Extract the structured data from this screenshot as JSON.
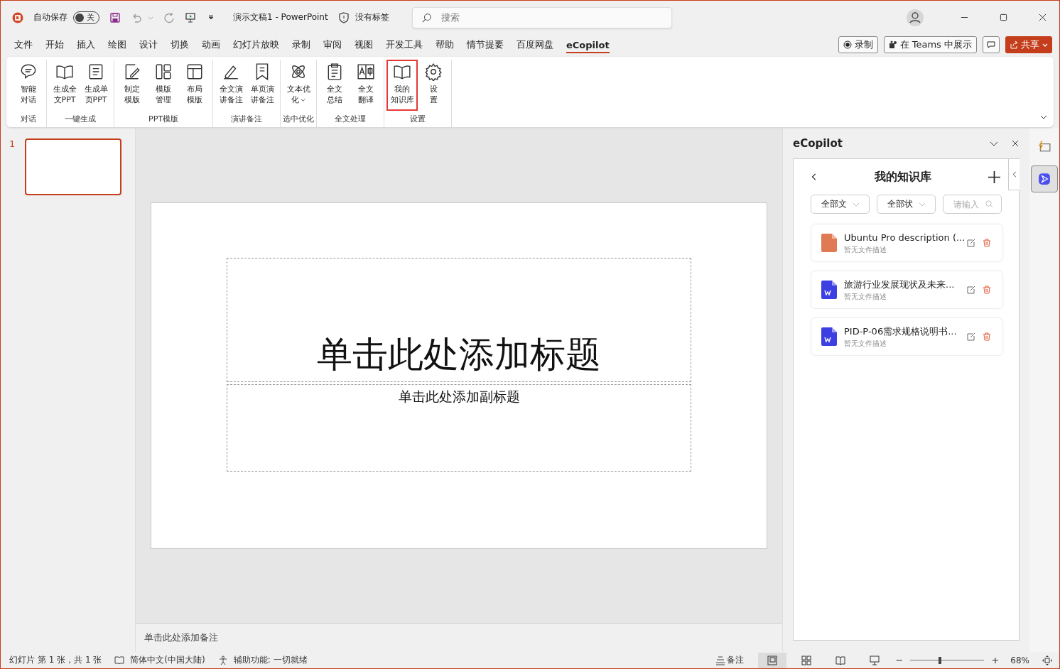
{
  "titlebar": {
    "autosave_label": "自动保存",
    "autosave": {
      "on": false,
      "label": "关"
    },
    "document_title": "演示文稿1  -  PowerPoint",
    "sensitivity": "没有标签",
    "search": {
      "placeholder": "搜索"
    }
  },
  "tabs": [
    {
      "label": "文件",
      "selected": false
    },
    {
      "label": "开始",
      "selected": false
    },
    {
      "label": "插入",
      "selected": false
    },
    {
      "label": "绘图",
      "selected": false
    },
    {
      "label": "设计",
      "selected": false
    },
    {
      "label": "切换",
      "selected": false
    },
    {
      "label": "动画",
      "selected": false
    },
    {
      "label": "幻灯片放映",
      "selected": false
    },
    {
      "label": "录制",
      "selected": false
    },
    {
      "label": "审阅",
      "selected": false
    },
    {
      "label": "视图",
      "selected": false
    },
    {
      "label": "开发工具",
      "selected": false
    },
    {
      "label": "帮助",
      "selected": false
    },
    {
      "label": "情节提要",
      "selected": false
    },
    {
      "label": "百度网盘",
      "selected": false
    },
    {
      "label": "eCopilot",
      "selected": true
    }
  ],
  "tab_actions": {
    "record": "录制",
    "teams": "在 Teams 中展示",
    "share": "共享"
  },
  "ribbon": {
    "groups": [
      {
        "label": "对话",
        "buttons": [
          {
            "label": [
              "智能",
              "对话"
            ],
            "highlighted": false
          }
        ]
      },
      {
        "label": "一键生成",
        "buttons": [
          {
            "label": [
              "生成全",
              "文PPT"
            ],
            "highlighted": false
          },
          {
            "label": [
              "生成单",
              "页PPT"
            ],
            "highlighted": false
          }
        ]
      },
      {
        "label": "PPT模版",
        "buttons": [
          {
            "label": [
              "制定",
              "模版"
            ],
            "highlighted": false
          },
          {
            "label": [
              "模版",
              "管理"
            ],
            "highlighted": false
          },
          {
            "label": [
              "布局",
              "模版"
            ],
            "highlighted": false
          }
        ]
      },
      {
        "label": "演讲备注",
        "buttons": [
          {
            "label": [
              "全文演",
              "讲备注"
            ],
            "highlighted": false
          },
          {
            "label": [
              "单页演",
              "讲备注"
            ],
            "highlighted": false
          }
        ]
      },
      {
        "label": "选中优化",
        "buttons": [
          {
            "label": [
              "文本优",
              "化"
            ],
            "highlighted": false,
            "dropdown": true
          }
        ]
      },
      {
        "label": "全文处理",
        "buttons": [
          {
            "label": [
              "全文",
              "总结"
            ],
            "highlighted": false
          },
          {
            "label": [
              "全文",
              "翻译"
            ],
            "highlighted": false
          }
        ]
      },
      {
        "label": "设置",
        "buttons": [
          {
            "label": [
              "我的",
              "知识库"
            ],
            "highlighted": true
          },
          {
            "label": [
              "设",
              "置"
            ],
            "highlighted": false
          }
        ]
      }
    ]
  },
  "slides": [
    {
      "number": "1",
      "selected": true
    }
  ],
  "slide": {
    "title_placeholder": "单击此处添加标题",
    "subtitle_placeholder": "单击此处添加副标题"
  },
  "notes": {
    "placeholder": "单击此处添加备注"
  },
  "pane": {
    "title": "eCopilot",
    "heading": "我的知识库",
    "filters": [
      {
        "label": "全部文"
      },
      {
        "label": "全部状"
      }
    ],
    "search": {
      "placeholder": "请输入"
    },
    "files": [
      {
        "kind": "pdf",
        "name": "Ubuntu Pro description (...",
        "description": "暂无文件描述"
      },
      {
        "kind": "word",
        "name": "旅游行业发展现状及未来...",
        "description": "暂无文件描述"
      },
      {
        "kind": "word",
        "name": "PID-P-06需求规格说明书...",
        "description": "暂无文件描述"
      }
    ]
  },
  "side_strip": [
    {
      "selected": false
    },
    {
      "selected": true
    }
  ],
  "status_bar": {
    "slide_info": "幻灯片 第 1 张，共 1 张",
    "language": "简体中文(中国大陆)",
    "accessibility": "辅助功能: 一切就绪",
    "notes": "备注",
    "views": [
      {
        "selected": true
      },
      {
        "selected": false
      },
      {
        "selected": false
      },
      {
        "selected": false
      }
    ],
    "zoom_out": "−",
    "zoom_in": "+",
    "zoom": {
      "level": 0.4
    },
    "zoom_text": "68%"
  }
}
